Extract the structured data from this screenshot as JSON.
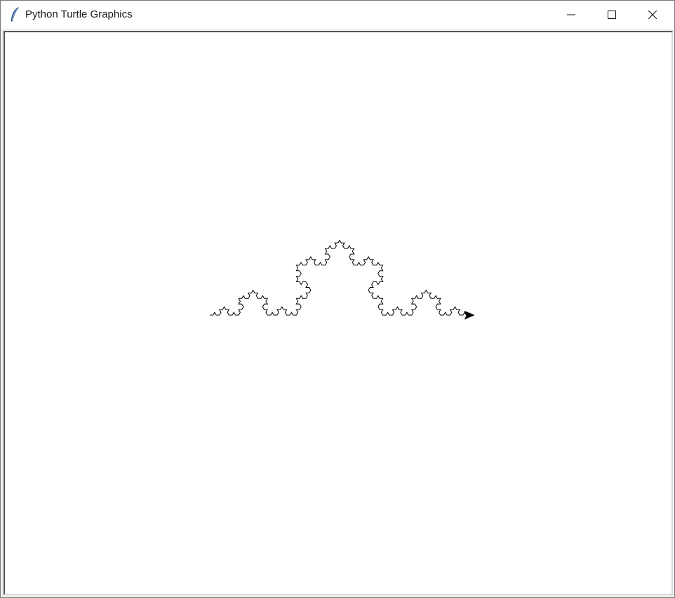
{
  "window": {
    "title": "Python Turtle Graphics",
    "app_icon": "feather-icon",
    "controls": {
      "minimize_icon": "minimize-icon",
      "maximize_icon": "maximize-icon",
      "close_icon": "close-icon"
    }
  },
  "canvas": {
    "background": "#ffffff",
    "pen_color": "#000000",
    "drawing": "koch-curve",
    "koch_depth": 4,
    "turtle_icon": "turtle-arrow-icon"
  }
}
